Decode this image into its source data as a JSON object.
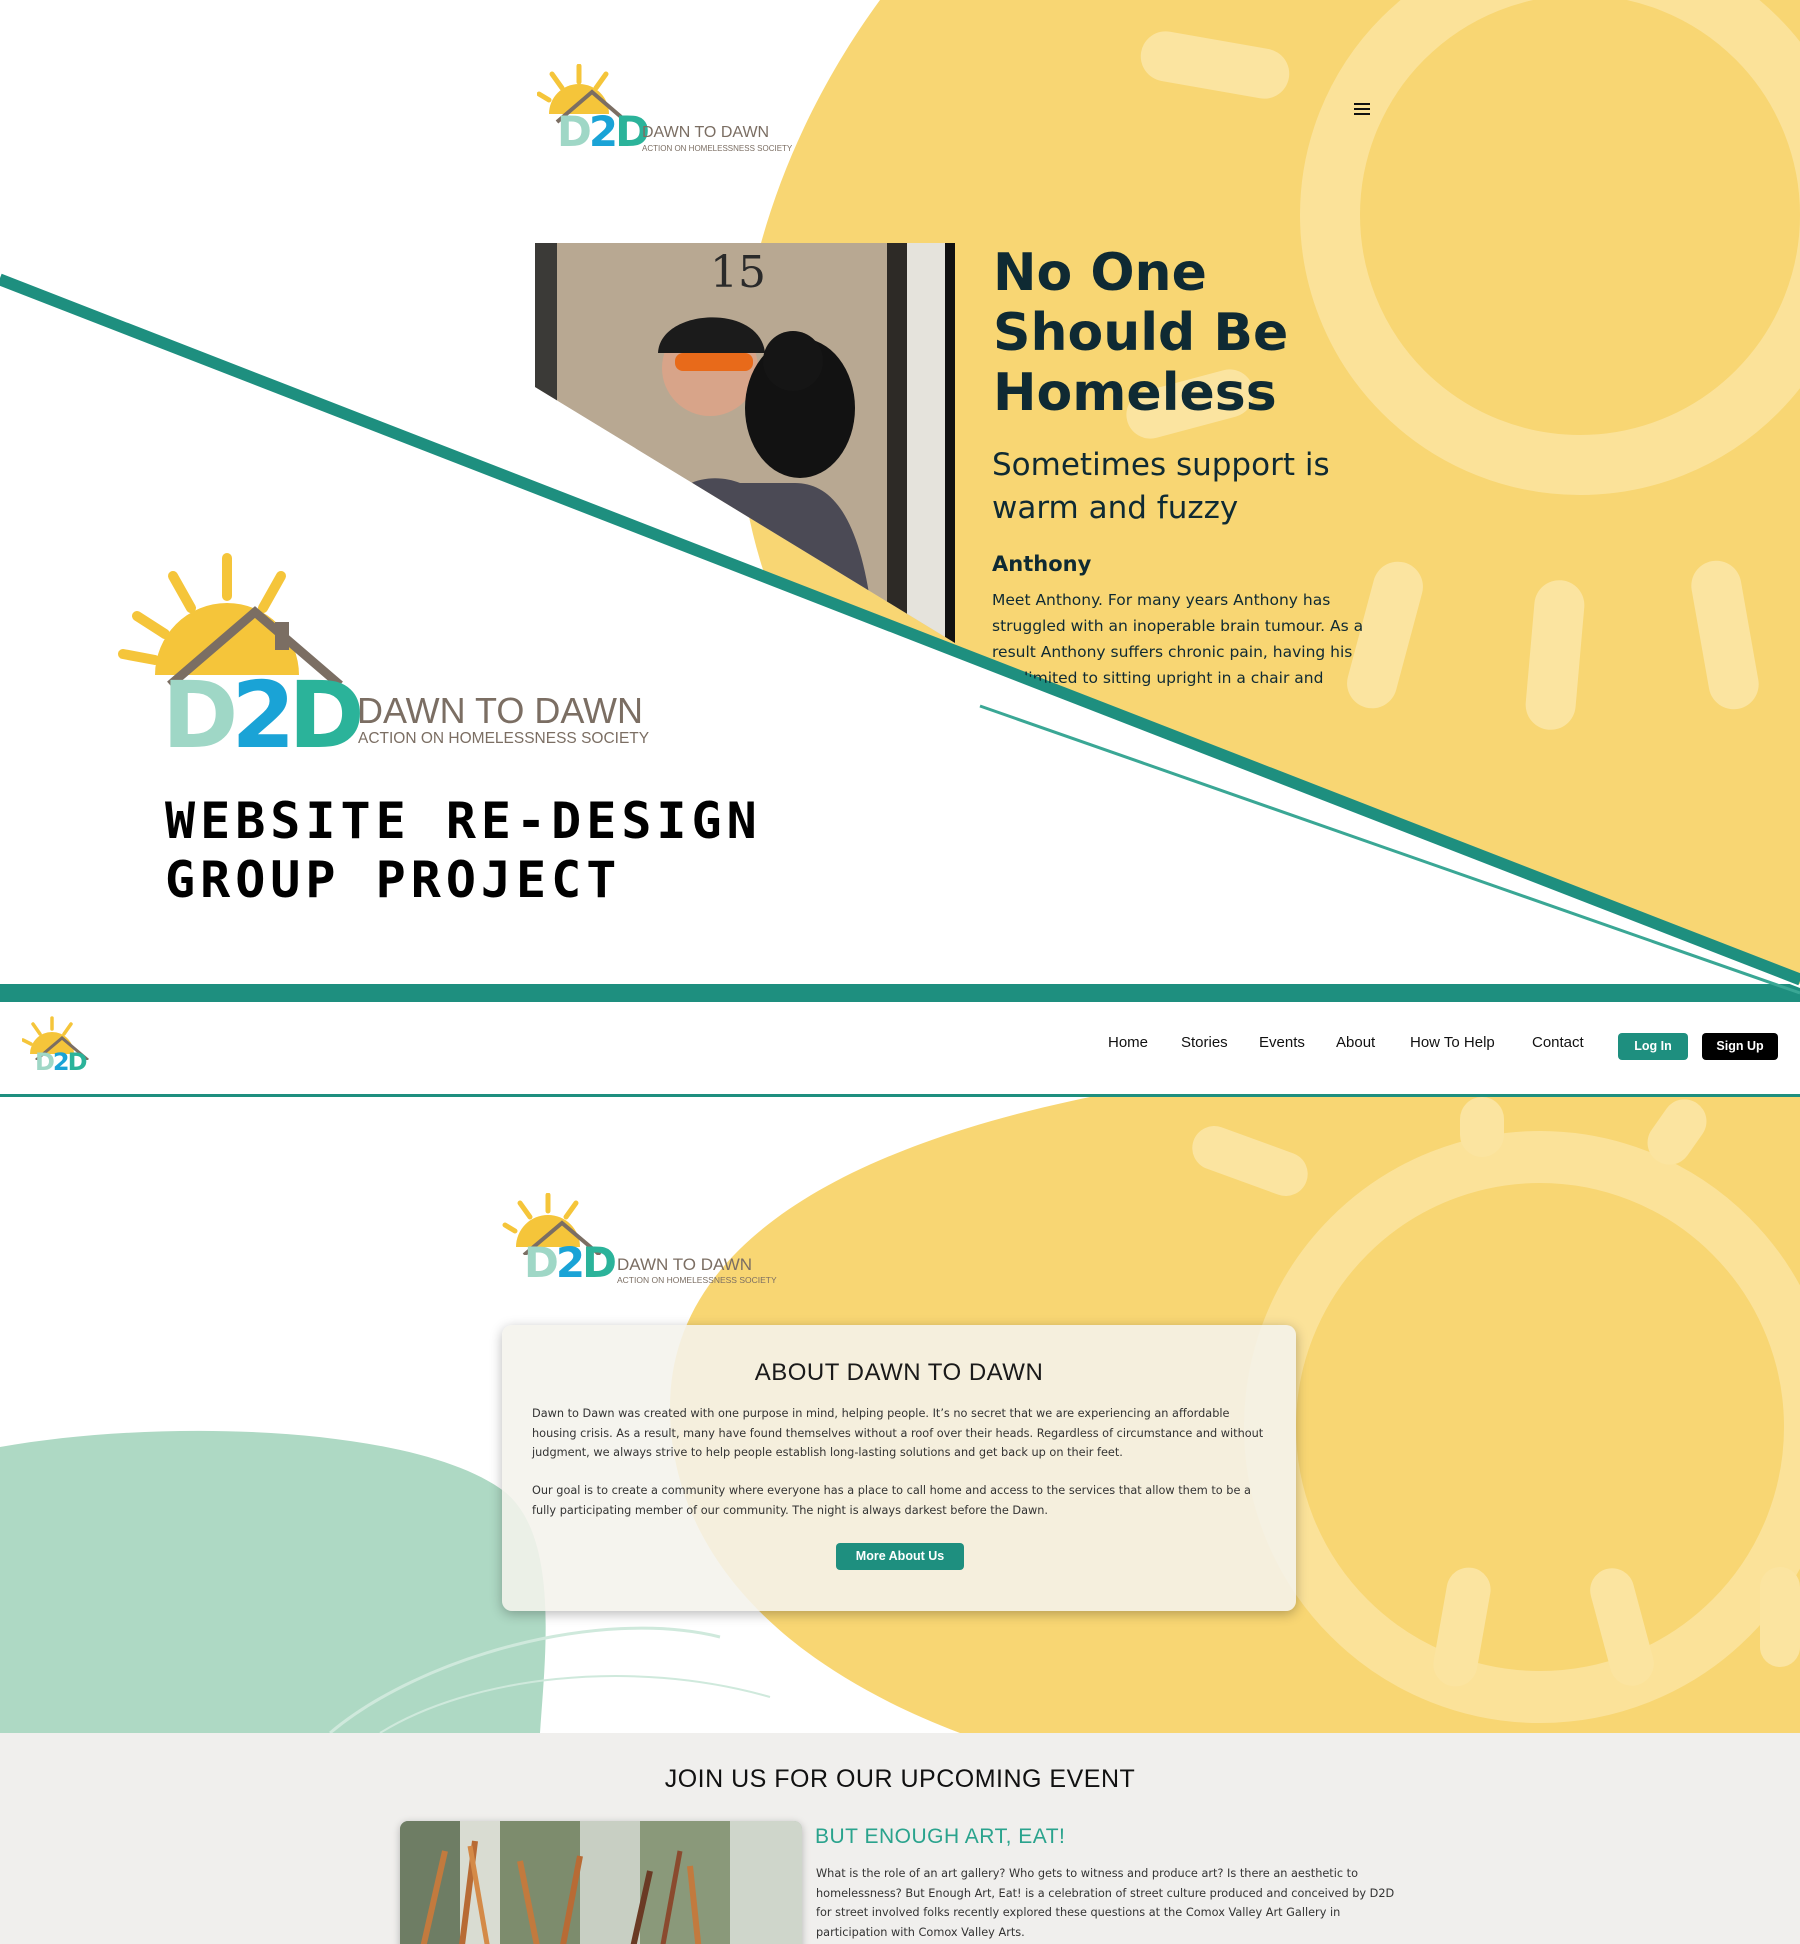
{
  "colors": {
    "sun_yellow": "#f8d673",
    "teal_accent": "#1e8f7f",
    "mint": "#aed9c4",
    "dark_text": "#0f2a33",
    "event_bg": "#f0efed"
  },
  "cover": {
    "logo": {
      "mark": {
        "d1": "D",
        "two": "2",
        "d2": "D"
      },
      "name": "DAWN TO DAWN",
      "tagline": "ACTION ON HOMELESSNESS SOCIETY"
    },
    "menu_icon": "hamburger-icon",
    "hero": {
      "photo_number": "15",
      "headline_lines": [
        "No One",
        "Should Be",
        "Homeless"
      ],
      "subheading_lines": [
        "Sometimes support is",
        "warm and fuzzy"
      ],
      "story_name": "Anthony",
      "story_lines": [
        "Meet Anthony. For many years Anthony has",
        "struggled with an inoperable brain tumour. As a",
        "result Anthony suffers chronic pain, having his",
        "limited to sitting upright in a chair and"
      ]
    },
    "project_title_lines": [
      "WEBSITE RE-DESIGN",
      "GROUP PROJECT"
    ]
  },
  "nav": {
    "links": [
      "Home",
      "Stories",
      "Events",
      "About",
      "How To Help",
      "Contact"
    ],
    "login_label": "Log In",
    "signup_label": "Sign Up"
  },
  "about": {
    "title": "ABOUT DAWN TO DAWN",
    "paragraph1_lines": [
      "Dawn to Dawn was created with one purpose in mind, helping people. It’s no secret that we are experiencing an affordable",
      "housing crisis. As a result, many have found themselves without a roof over their heads. Regardless of circumstance and without",
      "judgment, we always strive to help people establish long-lasting solutions and get back up on their feet."
    ],
    "paragraph2_lines": [
      "Our goal is to create a community where everyone has a place to call home and access to the services that allow them to be a",
      "fully participating member of our community. The night is always darkest before the Dawn."
    ],
    "button_label": "More About Us"
  },
  "event": {
    "heading": "JOIN US FOR OUR UPCOMING EVENT",
    "title": "BUT ENOUGH ART, EAT!",
    "description_lines": [
      "What is the role of an art gallery? Who gets to witness and produce art? Is there an aesthetic to",
      "homelessness? But Enough Art, Eat! is a celebration of street culture produced and conceived by D2D",
      "for street involved folks  recently explored these questions at the Comox Valley Art Gallery in",
      "participation with Comox Valley Arts."
    ]
  }
}
